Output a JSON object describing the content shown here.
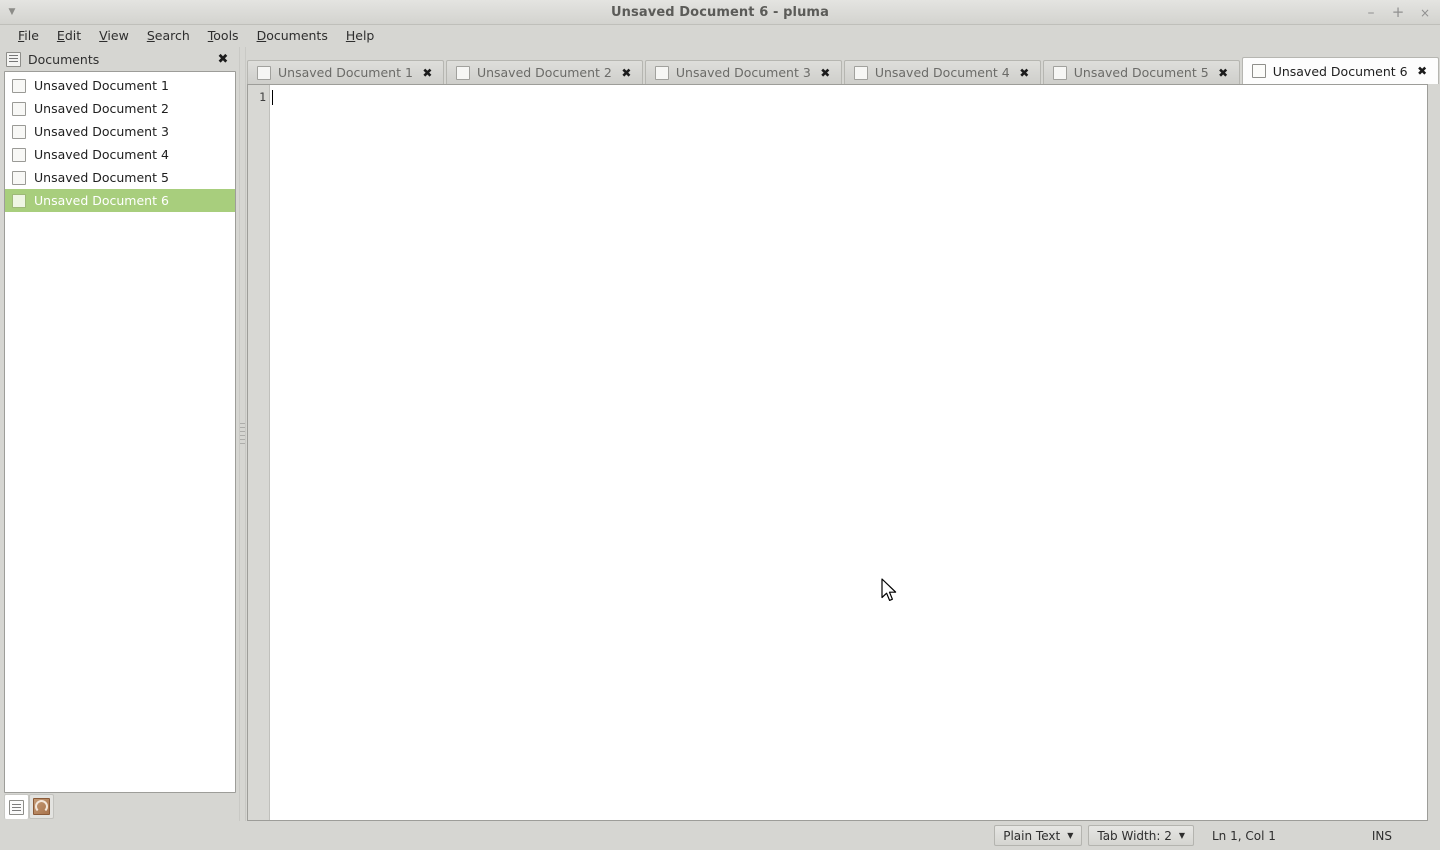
{
  "window": {
    "title": "Unsaved Document 6 - pluma",
    "menu_arrow_icon": "caret-down-icon",
    "controls": {
      "minimize": "–",
      "maximize": "+",
      "close": "×"
    }
  },
  "menubar": {
    "items": [
      {
        "label": "File",
        "mnemonic": "F",
        "rest": "ile"
      },
      {
        "label": "Edit",
        "mnemonic": "E",
        "rest": "dit"
      },
      {
        "label": "View",
        "mnemonic": "V",
        "rest": "iew"
      },
      {
        "label": "Search",
        "mnemonic": "S",
        "rest": "earch"
      },
      {
        "label": "Tools",
        "mnemonic": "T",
        "rest": "ools"
      },
      {
        "label": "Documents",
        "mnemonic": "D",
        "rest": "ocuments"
      },
      {
        "label": "Help",
        "mnemonic": "H",
        "rest": "elp"
      }
    ]
  },
  "sidebar": {
    "header": {
      "icon": "documents-panel-icon",
      "title": "Documents",
      "close_glyph": "✖"
    },
    "documents": [
      {
        "label": "Unsaved Document 1",
        "selected": false
      },
      {
        "label": "Unsaved Document 2",
        "selected": false
      },
      {
        "label": "Unsaved Document 3",
        "selected": false
      },
      {
        "label": "Unsaved Document 4",
        "selected": false
      },
      {
        "label": "Unsaved Document 5",
        "selected": false
      },
      {
        "label": "Unsaved Document 6",
        "selected": true
      }
    ],
    "bottom_buttons": [
      {
        "name": "documents-panel-button",
        "active": true
      },
      {
        "name": "file-browser-panel-button",
        "active": false
      }
    ],
    "selection_color": "#a8ce7d"
  },
  "tabs": [
    {
      "label": "Unsaved Document 1",
      "close_glyph": "✖",
      "active": false
    },
    {
      "label": "Unsaved Document 2",
      "close_glyph": "✖",
      "active": false
    },
    {
      "label": "Unsaved Document 3",
      "close_glyph": "✖",
      "active": false
    },
    {
      "label": "Unsaved Document 4",
      "close_glyph": "✖",
      "active": false
    },
    {
      "label": "Unsaved Document 5",
      "close_glyph": "✖",
      "active": false
    },
    {
      "label": "Unsaved Document 6",
      "close_glyph": "✖",
      "active": true
    }
  ],
  "editor": {
    "line_numbers": [
      "1"
    ],
    "content": ""
  },
  "statusbar": {
    "language": "Plain Text",
    "language_arrow": "▼",
    "tab_width": "Tab Width:  2",
    "tab_width_arrow": "▼",
    "position": "Ln 1, Col 1",
    "insert_mode": "INS"
  }
}
